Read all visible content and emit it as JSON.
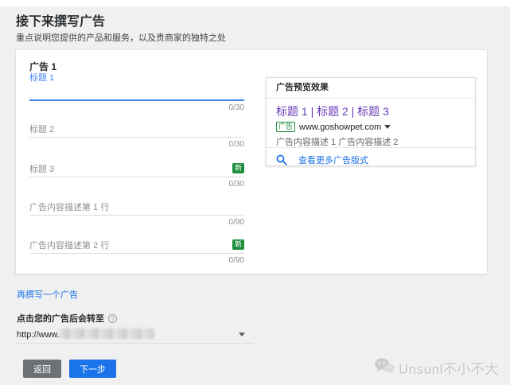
{
  "page": {
    "title": "接下来撰写广告",
    "subtitle": "重点说明您提供的产品和服务，以及贵商家的独特之处"
  },
  "ad_card": {
    "title": "广告 1",
    "fields": [
      {
        "label": "标题 1",
        "counter": "0/30",
        "state": "focused",
        "badge": ""
      },
      {
        "label": "标题 2",
        "counter": "0/30",
        "state": "empty",
        "badge": ""
      },
      {
        "label": "标题 3",
        "counter": "0/30",
        "state": "empty",
        "badge": "新"
      },
      {
        "label": "广告内容描述第 1 行",
        "counter": "0/90",
        "state": "empty",
        "badge": ""
      },
      {
        "label": "广告内容描述第 2 行",
        "counter": "0/90",
        "state": "empty",
        "badge": "新"
      }
    ]
  },
  "preview": {
    "title": "广告预览效果",
    "headline": "标题 1 | 标题 2 | 标题 3",
    "ad_badge": "广告",
    "display_url": "www.goshowpet.com",
    "description": "广告内容描述 1 广告内容描述 2",
    "more_link": "查看更多广告版式"
  },
  "actions": {
    "add_ad_link": "再撰写一个广告",
    "final_url_label": "点击您的广告后会转至",
    "help_glyph": "?",
    "final_url_prefix": "http://www.",
    "back_button": "返回",
    "next_button": "下一步"
  },
  "watermark": {
    "text": "Unsunl不小不大"
  },
  "colors": {
    "focus_blue": "#4285f4",
    "link_blue": "#1a73e8",
    "badge_green": "#1e8e3e",
    "headline_purple": "#673ab7",
    "back_button_gray": "#6d7175",
    "page_background": "#f0f0f1"
  }
}
